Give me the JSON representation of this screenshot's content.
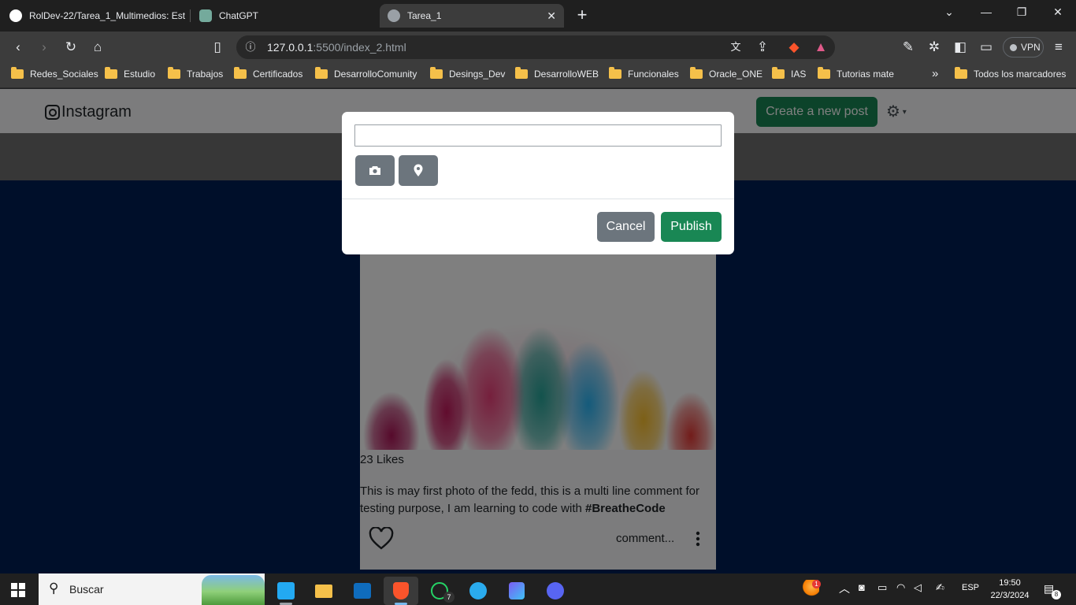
{
  "browser": {
    "tabs": [
      {
        "title": "RolDev-22/Tarea_1_Multimedios: Est",
        "active": false
      },
      {
        "title": "ChatGPT",
        "active": false
      },
      {
        "title": "Tarea_1",
        "active": true
      }
    ],
    "tab_close_glyph": "✕",
    "new_tab_glyph": "+",
    "url_host": "127.0.0.1",
    "url_rest": ":5500/index_2.html",
    "vpn_label": "VPN",
    "bookmarks": [
      "Redes_Sociales",
      "Estudio",
      "Trabajos",
      "Certificados",
      "DesarrolloComunity",
      "Desings_Dev",
      "DesarrolloWEB",
      "Funcionales",
      "Oracle_ONE",
      "IAS",
      "Tutorias mate"
    ],
    "bookmarks_overflow": "»",
    "all_bookmarks": "Todos los marcadores"
  },
  "page": {
    "brand": "Instagram",
    "create_post_label": "Create a new post",
    "post": {
      "likes": "23 Likes",
      "caption": "This is may first photo of the fedd, this is a multi line comment for testing purpose, I am learning to code with ",
      "hashtag": "#BreatheCode",
      "comment_link": "comment..."
    },
    "modal": {
      "input_value": "",
      "cancel_label": "Cancel",
      "publish_label": "Publish"
    }
  },
  "taskbar": {
    "search_label": "Buscar",
    "whatsapp_badge": "7",
    "weather_badge": "1",
    "language": "ESP",
    "time": "19:50",
    "date": "22/3/2024",
    "notifications": "8"
  },
  "colors": {
    "page_background": "#001f54",
    "success": "#198754",
    "secondary": "#6c757d"
  },
  "icons": [
    "github-icon",
    "chatgpt-icon",
    "globe-icon",
    "camera-icon",
    "location-pin-icon",
    "heart-icon",
    "kebab-icon",
    "gear-icon",
    "instagram-icon",
    "windows-icon",
    "search-icon"
  ]
}
